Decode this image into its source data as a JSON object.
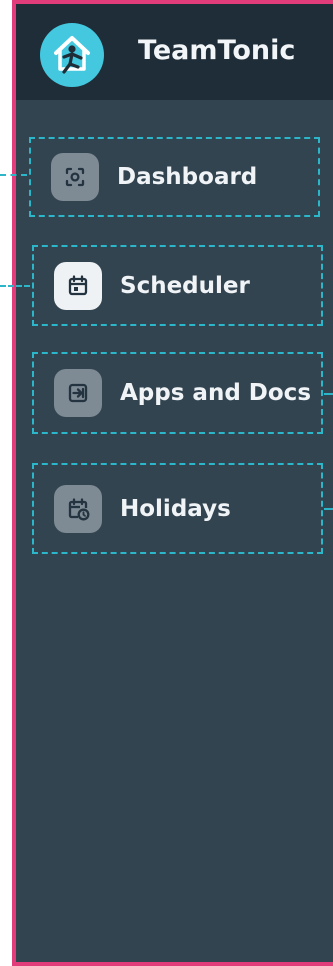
{
  "app": {
    "name": "TeamTonic"
  },
  "sidebar": {
    "items": [
      {
        "label": "Dashboard",
        "icon": "focus-icon",
        "active": false
      },
      {
        "label": "Scheduler",
        "icon": "calendar-icon",
        "active": true
      },
      {
        "label": "Apps and Docs",
        "icon": "import-icon",
        "active": false
      },
      {
        "label": "Holidays",
        "icon": "calendar-clock-icon",
        "active": false
      }
    ]
  },
  "colors": {
    "frame": "#e23c7a",
    "sidebar_bg": "#334451",
    "header_bg": "#1f2d38",
    "logo_bg": "#43c8e0",
    "highlight_dash": "#2bb6c9"
  }
}
